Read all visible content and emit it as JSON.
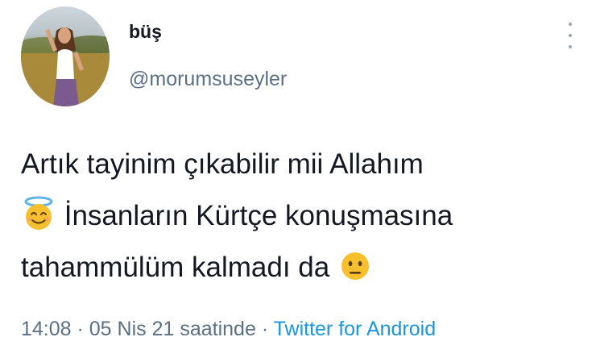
{
  "user": {
    "display_name": "büş",
    "handle": "@morumsuseyler"
  },
  "tweet": {
    "line1": "Artık tayinim çıkabilir mii Allahım",
    "line2_text": "İnsanların Kürtçe konuşmasına",
    "line3_text": "tahammülüm kalmadı da",
    "emoji1": "smiling-face-with-halo",
    "emoji2": "neutral-face"
  },
  "meta": {
    "time": "14:08",
    "separator1": " · ",
    "date": "05 Nis 21 saatinde",
    "separator2": " · ",
    "source": "Twitter for Android"
  },
  "colors": {
    "text": "#141823",
    "muted": "#5b7083",
    "link": "#1b95e0",
    "emoji_yellow": "#f7c02c",
    "halo_blue": "#5fb4e8"
  }
}
